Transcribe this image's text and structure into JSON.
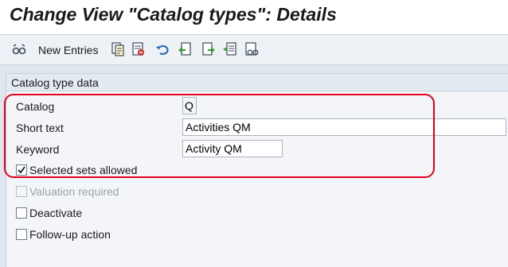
{
  "window": {
    "title": "Change View \"Catalog types\": Details"
  },
  "toolbar": {
    "new_entries_label": "New Entries",
    "icons": [
      "glasses-icon",
      "copy-icon",
      "delete-icon",
      "undo-icon",
      "previous-entry-icon",
      "next-entry-icon",
      "select-all-icon",
      "display-icon"
    ]
  },
  "panel": {
    "title": "Catalog type data",
    "fields": {
      "catalog_label": "Catalog",
      "catalog_value": "Q",
      "short_text_label": "Short text",
      "short_text_value": "Activities QM",
      "keyword_label": "Keyword",
      "keyword_value": "Activity QM"
    },
    "checkboxes": {
      "selected_sets": {
        "label": "Selected sets allowed",
        "checked": true,
        "enabled": true
      },
      "valuation_required": {
        "label": "Valuation required",
        "checked": false,
        "enabled": false
      },
      "deactivate": {
        "label": "Deactivate",
        "checked": false,
        "enabled": true
      },
      "follow_up": {
        "label": "Follow-up action",
        "checked": false,
        "enabled": true
      }
    }
  },
  "colors": {
    "highlight": "#e3001b",
    "background": "#dfe6ee"
  }
}
